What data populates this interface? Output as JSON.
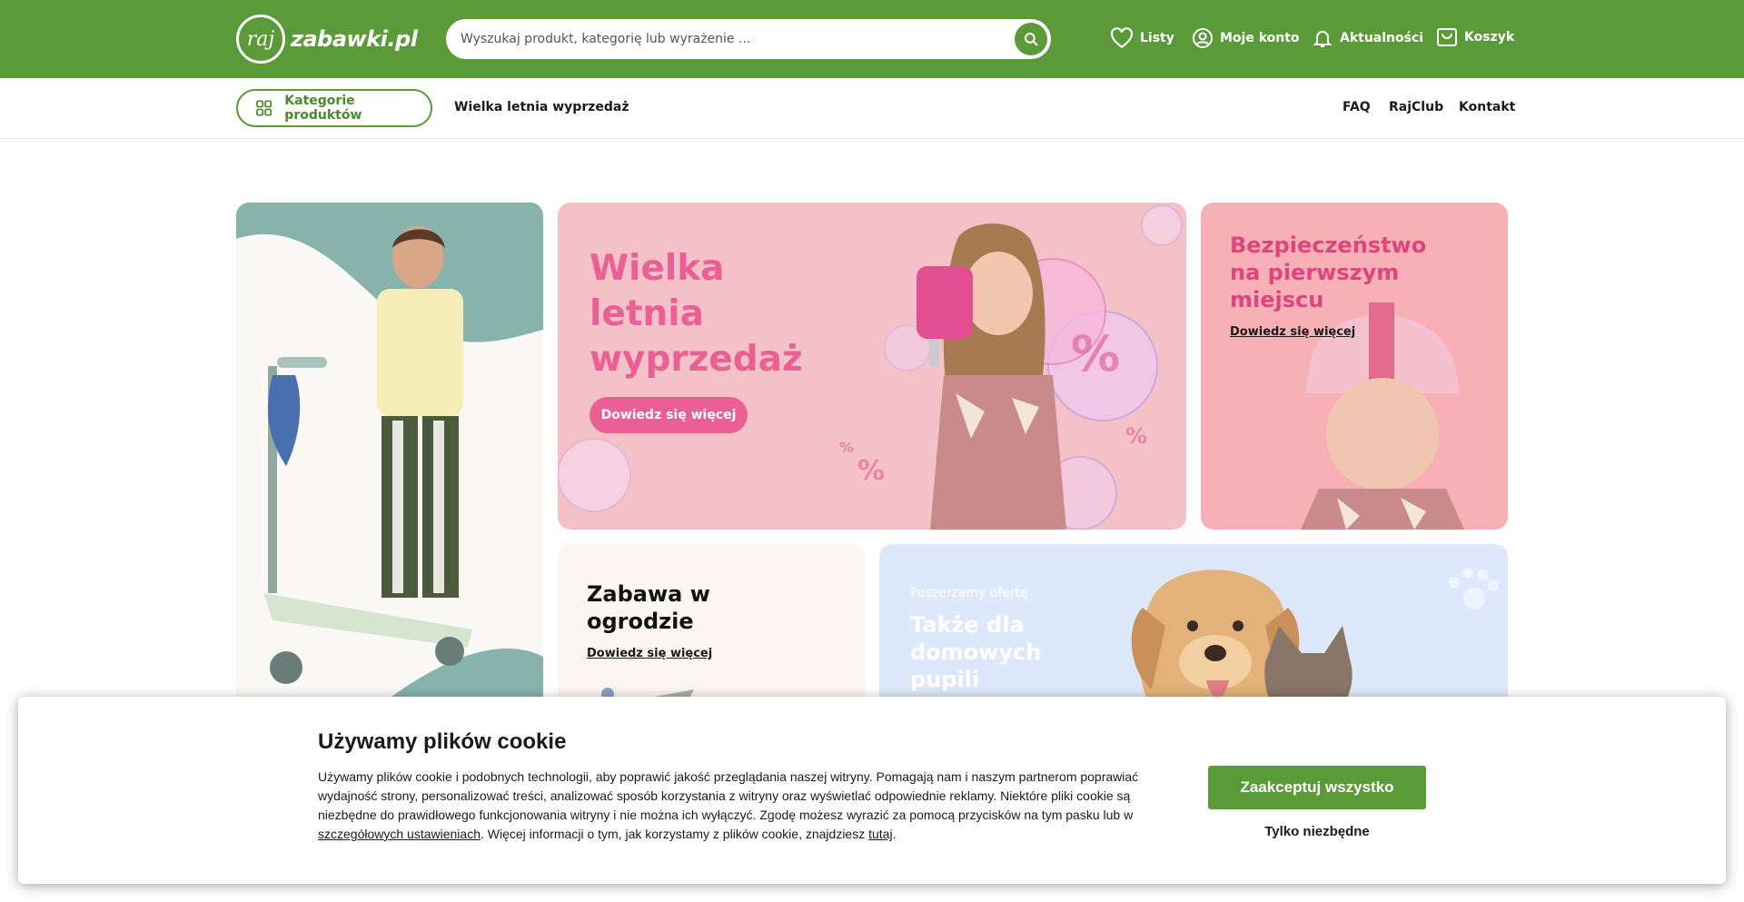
{
  "header": {
    "logo_prefix": "raj",
    "logo_text": "zabawki.pl",
    "search_placeholder": "Wyszukaj produkt, kategorię lub wyrażenie ...",
    "nav": [
      {
        "label": "Listy",
        "icon": "heart-icon"
      },
      {
        "label": "Moje konto",
        "icon": "user-icon"
      },
      {
        "label": "Aktualności",
        "icon": "bell-icon"
      },
      {
        "label": "Koszyk",
        "icon": "cart-icon"
      }
    ]
  },
  "subnav": {
    "categories_label": "Kategorie produktów",
    "sale_link": "Wielka letnia wyprzedaż",
    "right_links": [
      "FAQ",
      "RajClub",
      "Kontakt"
    ]
  },
  "banners": {
    "sale": {
      "title_lines": [
        "Wielka",
        "letnia",
        "wyprzedaż"
      ],
      "cta": "Dowiedz się więcej"
    },
    "safety": {
      "title_lines": [
        "Bezpieczeństwo",
        "na pierwszym",
        "miejscu"
      ],
      "cta": "Dowiedz się więcej"
    },
    "garden": {
      "title_lines": [
        "Zabawa w",
        "ogrodzie"
      ],
      "cta": "Dowiedz się więcej"
    },
    "pets": {
      "eyebrow": "Poszerzamy ofertę",
      "title_lines": [
        "Także dla",
        "domowych",
        "pupili"
      ]
    }
  },
  "cookie": {
    "title": "Używamy plików cookie",
    "text_before_link": "Używamy plików cookie i podobnych technologii, aby poprawić jakość przeglądania naszej witryny. Pomagają nam i naszym partnerom poprawiać wydajność strony, personalizować treści, analizować sposób korzystania z witryny oraz wyświetlać odpowiednie reklamy. Niektóre pliki cookie są niezbędne do prawidłowego funkcjonowania witryny i nie można ich wyłączyć. Zgodę możesz wyrazić za pomocą przycisków na tym pasku lub w ",
    "settings_link": "szczegółowych ustawieniach",
    "text_middle": ". Więcej informacji o tym, jak korzystamy z plików cookie, znajdziesz ",
    "here_link": "tutaj",
    "text_end": ".",
    "accept_all": "Zaakceptuj wszystko",
    "only_necessary": "Tylko niezbędne"
  },
  "colors": {
    "brand_green": "#5a9a38",
    "sale_pink": "#f4c2c6",
    "safety_pink": "#f6b0b6",
    "pets_blue": "#dde9fb",
    "garden_cream": "#fbf6f2",
    "scooter_teal": "#88b3ad"
  }
}
